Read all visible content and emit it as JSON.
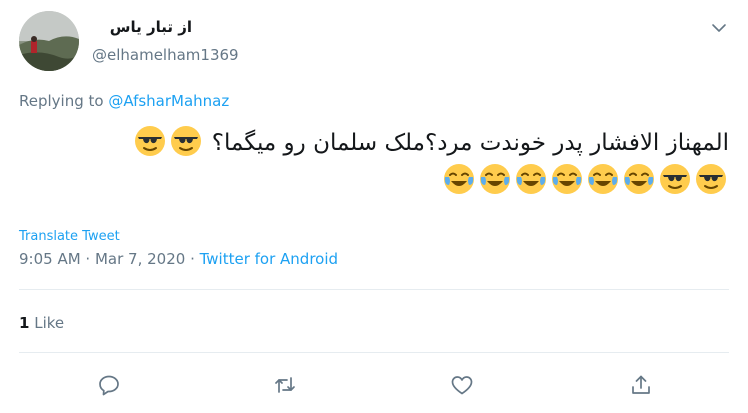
{
  "user": {
    "display_name": "از تبار یاس",
    "handle": "@elhamelham1369"
  },
  "reply": {
    "prefix": "Replying to ",
    "mention": "@AfsharMahnaz"
  },
  "tweet": {
    "line1": "المهناز الافشار پدر خوندت مرد؟ملک سلمان رو میگما؟",
    "emojis_line1": [
      "sunglasses-emoji",
      "sunglasses-emoji"
    ],
    "emojis_line2": [
      "sunglasses-emoji",
      "sunglasses-emoji",
      "joy-emoji",
      "joy-emoji",
      "joy-emoji",
      "joy-emoji",
      "joy-emoji",
      "joy-emoji"
    ]
  },
  "translate_label": "Translate Tweet",
  "meta": {
    "time_date": "9:05 AM · Mar 7, 2020",
    "separator": " · ",
    "source": "Twitter for Android"
  },
  "stats": {
    "likes_count": "1",
    "likes_label": " Like"
  },
  "actions": {
    "icons": [
      "reply-icon",
      "retweet-icon",
      "like-icon",
      "share-icon"
    ]
  },
  "colors": {
    "accent": "#1da1f2",
    "secondary_text": "#657786",
    "primary_text": "#14171a",
    "divider": "#e6ecf0"
  }
}
